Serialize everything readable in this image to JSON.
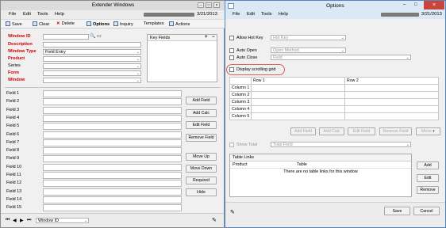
{
  "left_window": {
    "title": "Extender Windows",
    "menu": [
      "File",
      "Edit",
      "Tools",
      "Help"
    ],
    "date": "3/21/2013",
    "toolbar": [
      "Save",
      "Clear",
      "Delete",
      "Options",
      "Inquiry",
      "Templates",
      "Actions"
    ],
    "labels": {
      "window_id": "Window ID",
      "description": "Description",
      "window_type": "Window Type",
      "product": "Product",
      "series": "Series",
      "form": "Form",
      "window": "Window"
    },
    "window_type_value": "Field Entry",
    "key_fields_header": "Key Fields",
    "key_fields_plus": "+",
    "key_fields_minus": "−",
    "fields": [
      "Field 1",
      "Field 2",
      "Field 3",
      "Field 4",
      "Field 5",
      "Field 6",
      "Field 7",
      "Field 8",
      "Field 9",
      "Field 10",
      "Field 11",
      "Field 12",
      "Field 13",
      "Field 14",
      "Field 15"
    ],
    "buttons": [
      "Add Field",
      "Add Calc",
      "Edit Field",
      "Remove Field",
      "Move Up",
      "Move Down",
      "Required",
      "Hide"
    ],
    "footer_value": "Window ID"
  },
  "right_window": {
    "title": "Options",
    "menu": [
      "File",
      "Edit",
      "Tools",
      "Help"
    ],
    "date": "3/21/2013",
    "allow_hot_key": "Allow Hot Key",
    "hot_key_placeholder": "Hot Key",
    "auto_open": "Auto Open",
    "open_method_placeholder": "Open Method",
    "auto_close": "Auto Close",
    "field_placeholder": "Field",
    "display_scrolling_grid": "Display scrolling grid",
    "grid": {
      "columns": [
        "Row 1",
        "Row 2"
      ],
      "rows": [
        "Column 1",
        "Column 2",
        "Column 3",
        "Column 4",
        "Column 5"
      ]
    },
    "grid_buttons": [
      "Add Field",
      "Add Calc",
      "Edit Field",
      "Remove Field",
      "Move"
    ],
    "show_total": "Show Total",
    "total_field_placeholder": "Total Field",
    "table_links": {
      "title": "Table Links",
      "headers": [
        "Product",
        "Table"
      ],
      "empty_message": "There are no table links for this window"
    },
    "side_buttons": [
      "Add",
      "Edit",
      "Remove"
    ],
    "save_label": "Save",
    "cancel_label": "Cancel"
  },
  "colors": {
    "required_label": "#d00000",
    "highlight_ring": "#e06060",
    "accent": "#4f86c4"
  }
}
